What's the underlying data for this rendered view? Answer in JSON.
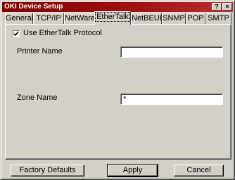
{
  "window": {
    "title": "OKI Device Setup",
    "help_glyph": "?",
    "close_glyph": "×",
    "titlebar_color": "#800000"
  },
  "tabs": [
    {
      "label": "General",
      "active": false
    },
    {
      "label": "TCP/IP",
      "active": false
    },
    {
      "label": "NetWare",
      "active": false
    },
    {
      "label": "EtherTalk",
      "active": true
    },
    {
      "label": "NetBEUI",
      "active": false
    },
    {
      "label": "SNMP",
      "active": false
    },
    {
      "label": "POP",
      "active": false
    },
    {
      "label": "SMTP",
      "active": false
    }
  ],
  "ethertalk": {
    "use_protocol_label": "Use EtherTalk Protocol",
    "use_protocol_checked": true,
    "printer_name_label": "Printer Name",
    "printer_name_value": "",
    "zone_name_label": "Zone Name",
    "zone_name_value": "*"
  },
  "buttons": {
    "factory_defaults": "Factory Defaults",
    "apply": "Apply",
    "cancel": "Cancel"
  }
}
